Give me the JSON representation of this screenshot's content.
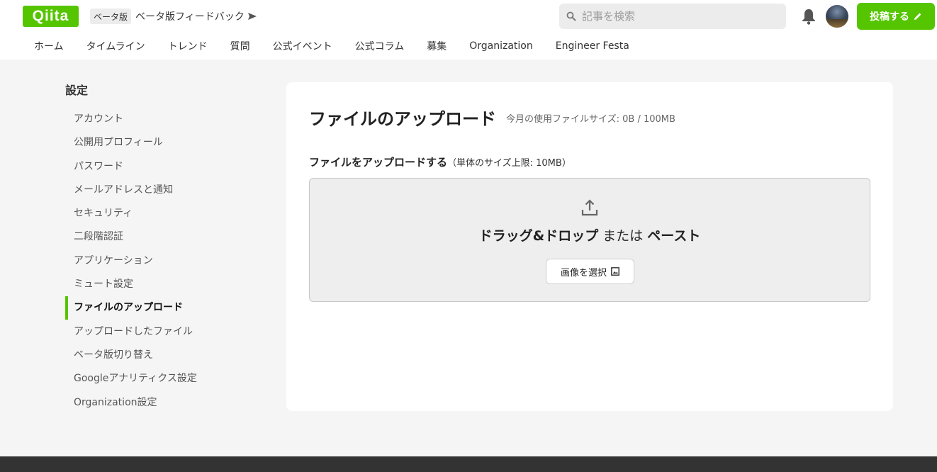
{
  "header": {
    "logo_text": "Qiita",
    "beta_badge": "ベータ版",
    "beta_feedback": "ベータ版フィードバック",
    "search_placeholder": "記事を検索",
    "post_button": "投稿する",
    "brand_color": "#55c500"
  },
  "nav": {
    "items": [
      "ホーム",
      "タイムライン",
      "トレンド",
      "質問",
      "公式イベント",
      "公式コラム",
      "募集",
      "Organization",
      "Engineer Festa"
    ]
  },
  "sidebar": {
    "title": "設定",
    "items": [
      "アカウント",
      "公開用プロフィール",
      "パスワード",
      "メールアドレスと通知",
      "セキュリティ",
      "二段階認証",
      "アプリケーション",
      "ミュート設定",
      "ファイルのアップロード",
      "アップロードしたファイル",
      "ベータ版切り替え",
      "Googleアナリティクス設定",
      "Organization設定"
    ],
    "active_index": 8
  },
  "main": {
    "title": "ファイルのアップロード",
    "usage": "今月の使用ファイルサイズ: 0B / 100MB",
    "upload_label": "ファイルをアップロードする",
    "upload_limit": "（単体のサイズ上限: 10MB）",
    "drop_text_drag": "ドラッグ&ドロップ",
    "drop_text_or": " または ",
    "drop_text_paste": "ペースト",
    "select_image_button": "画像を選択"
  }
}
